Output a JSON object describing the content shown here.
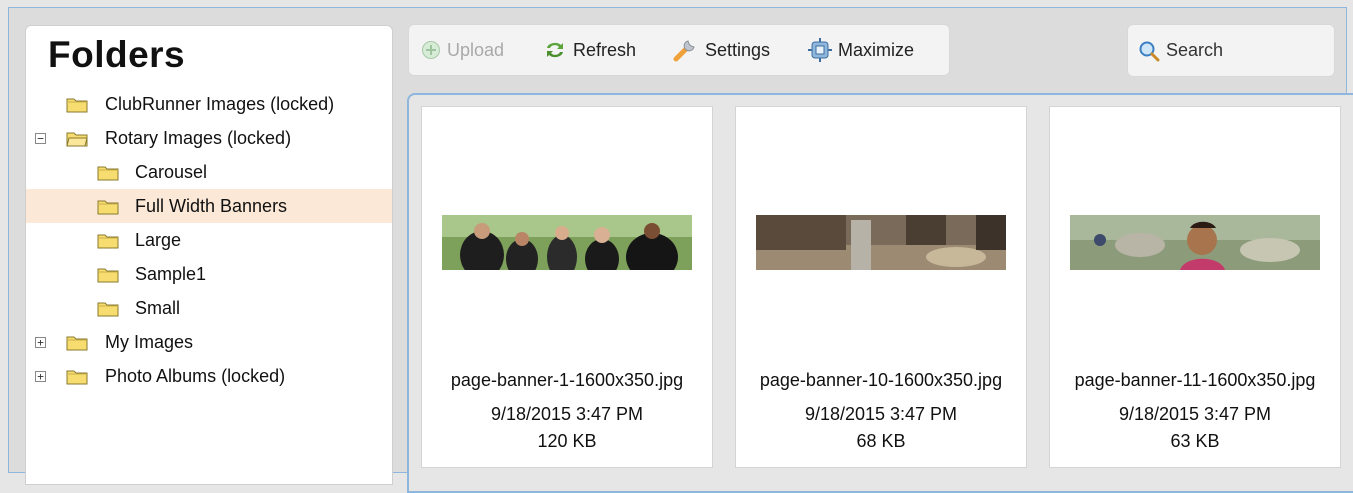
{
  "folders": {
    "title": "Folders",
    "items": [
      {
        "label": "ClubRunner Images (locked)",
        "expander": "",
        "selected": false
      },
      {
        "label": "Rotary Images (locked)",
        "expander": "−",
        "selected": false
      },
      {
        "label": "Carousel",
        "expander": "",
        "selected": false
      },
      {
        "label": "Full Width Banners",
        "expander": "",
        "selected": true
      },
      {
        "label": "Large",
        "expander": "",
        "selected": false
      },
      {
        "label": "Sample1",
        "expander": "",
        "selected": false
      },
      {
        "label": "Small",
        "expander": "",
        "selected": false
      },
      {
        "label": "My Images",
        "expander": "+",
        "selected": false
      },
      {
        "label": "Photo Albums (locked)",
        "expander": "+",
        "selected": false
      }
    ]
  },
  "toolbar": {
    "upload_label": "Upload",
    "refresh_label": "Refresh",
    "settings_label": "Settings",
    "maximize_label": "Maximize"
  },
  "search": {
    "placeholder": "Search"
  },
  "files": [
    {
      "name": "page-banner-1-1600x350.jpg",
      "date": "9/18/2015 3:47 PM",
      "size": "120 KB"
    },
    {
      "name": "page-banner-10-1600x350.jpg",
      "date": "9/18/2015 3:47 PM",
      "size": "68 KB"
    },
    {
      "name": "page-banner-11-1600x350.jpg",
      "date": "9/18/2015 3:47 PM",
      "size": "63 KB"
    }
  ],
  "colors": {
    "selected_row": "#fbe8d6",
    "panel_border": "#8fb6dd",
    "folder_yellow": "#f7dc6f"
  }
}
